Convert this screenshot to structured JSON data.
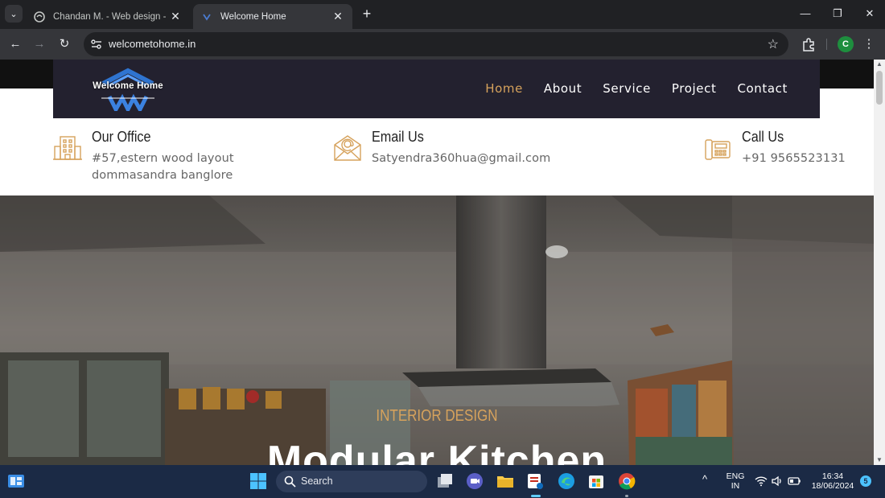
{
  "browser": {
    "tabs": [
      {
        "title": "Chandan M. - Web design - Up",
        "active": false
      },
      {
        "title": "Welcome Home",
        "active": true
      }
    ],
    "new_tab": "+",
    "url": "welcometohome.in",
    "profile_initial": "C"
  },
  "site": {
    "logo_text": "Welcome Home",
    "nav": [
      "Home",
      "About",
      "Service",
      "Project",
      "Contact"
    ],
    "active_nav": "Home",
    "contact": {
      "office": {
        "title": "Our Office",
        "lines": [
          "#57,estern wood layout",
          "dommasandra banglore"
        ]
      },
      "email": {
        "title": "Email Us",
        "lines": [
          "Satyendra360hua@gmail.com"
        ]
      },
      "phone": {
        "title": "Call Us",
        "lines": [
          "+91 9565523131"
        ]
      }
    },
    "hero": {
      "subtitle": "INTERIOR DESIGN",
      "title": "Modular Kitchen"
    },
    "colors": {
      "accent": "#d6a25c",
      "nav_bg": "#23212f"
    }
  },
  "taskbar": {
    "search_label": "Search",
    "language": [
      "ENG",
      "IN"
    ],
    "time": "16:34",
    "date": "18/06/2024",
    "notification_count": "5"
  }
}
